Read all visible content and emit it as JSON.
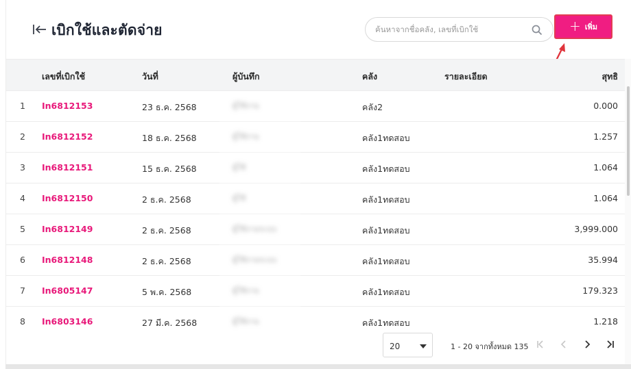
{
  "header": {
    "title": "เบิกใช้และตัดจ่าย",
    "search_placeholder": "ค้นหาจากชื่อคลัง, เลขที่เบิกใช้",
    "add_label": "เพิ่ม"
  },
  "table": {
    "columns": [
      "เลขที่เบิกใช้",
      "วันที่",
      "ผู้บันทึก",
      "คลัง",
      "รายละเอียด",
      "สุทธิ"
    ],
    "rows": [
      {
        "idx": "1",
        "doc": "In6812153",
        "date": "23 ธ.ค. 2568",
        "user": "ผู้ใช้งาน",
        "warehouse": "คลัง2",
        "net": "0.000"
      },
      {
        "idx": "2",
        "doc": "In6812152",
        "date": "18 ธ.ค. 2568",
        "user": "ผู้ใช้งาน",
        "warehouse": "คลัง1ทดสอบ",
        "net": "1.257"
      },
      {
        "idx": "3",
        "doc": "In6812151",
        "date": "15 ธ.ค. 2568",
        "user": "ผู้ใช้",
        "warehouse": "คลัง1ทดสอบ",
        "net": "1.064"
      },
      {
        "idx": "4",
        "doc": "In6812150",
        "date": "2 ธ.ค. 2568",
        "user": "ผู้ใช้",
        "warehouse": "คลัง1ทดสอบ",
        "net": "1.064"
      },
      {
        "idx": "5",
        "doc": "In6812149",
        "date": "2 ธ.ค. 2568",
        "user": "ผู้ใช้งานระบบ",
        "warehouse": "คลัง1ทดสอบ",
        "net": "3,999.000"
      },
      {
        "idx": "6",
        "doc": "In6812148",
        "date": "2 ธ.ค. 2568",
        "user": "ผู้ใช้งานระบบ",
        "warehouse": "คลัง1ทดสอบ",
        "net": "35.994"
      },
      {
        "idx": "7",
        "doc": "In6805147",
        "date": "5 พ.ค. 2568",
        "user": "ผู้ใช้งาน",
        "warehouse": "คลัง1ทดสอบ",
        "net": "179.323"
      },
      {
        "idx": "8",
        "doc": "In6803146",
        "date": "27 มี.ค. 2568",
        "user": "ผู้ใช้งาน",
        "warehouse": "คลัง1ทดสอบ",
        "net": "1.218"
      }
    ]
  },
  "pagination": {
    "page_size": "20",
    "range_text": "1 - 20 จากทั้งหมด 135"
  }
}
